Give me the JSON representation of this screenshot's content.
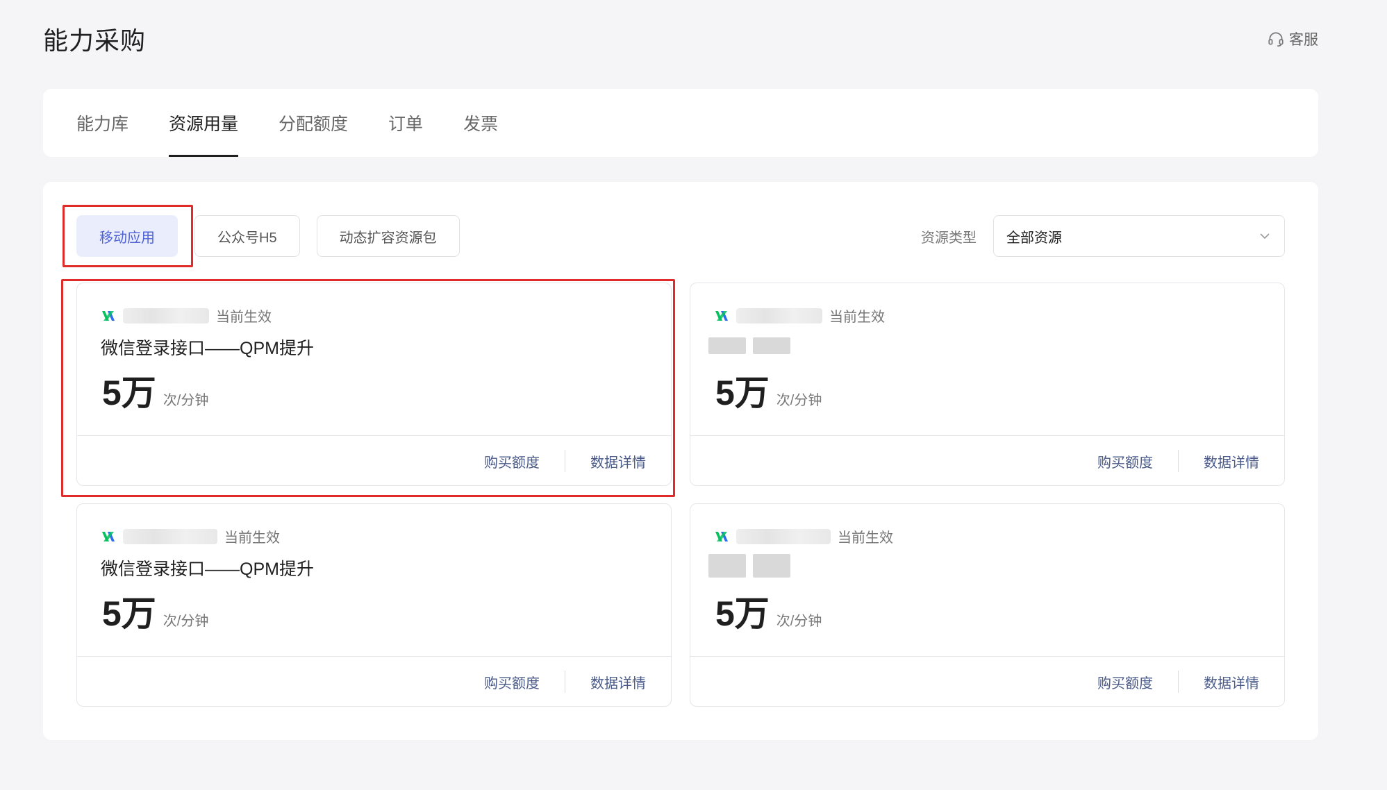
{
  "header": {
    "title": "能力采购",
    "service_label": "客服"
  },
  "tabs": [
    {
      "label": "能力库"
    },
    {
      "label": "资源用量",
      "active": true
    },
    {
      "label": "分配额度"
    },
    {
      "label": "订单"
    },
    {
      "label": "发票"
    }
  ],
  "filters": [
    {
      "label": "移动应用",
      "active": true
    },
    {
      "label": "公众号H5"
    },
    {
      "label": "动态扩容资源包"
    }
  ],
  "resource_type": {
    "label": "资源类型",
    "selected": "全部资源"
  },
  "cards": [
    {
      "status": "当前生效",
      "title": "微信登录接口——QPM提升",
      "value": "5万",
      "unit": "次/分钟",
      "buy_label": "购买额度",
      "detail_label": "数据详情"
    },
    {
      "status": "当前生效",
      "title": "",
      "value": "5万",
      "unit": "次/分钟",
      "buy_label": "购买额度",
      "detail_label": "数据详情"
    },
    {
      "status": "当前生效",
      "title": "微信登录接口——QPM提升",
      "value": "5万",
      "unit": "次/分钟",
      "buy_label": "购买额度",
      "detail_label": "数据详情"
    },
    {
      "status": "当前生效",
      "title": "",
      "value": "5万",
      "unit": "次/分钟",
      "buy_label": "购买额度",
      "detail_label": "数据详情"
    }
  ],
  "colors": {
    "accent": "#4e62d4",
    "highlight": "#e02b2b",
    "brand_green": "#07c160",
    "brand_blue": "#2b6cf0"
  }
}
